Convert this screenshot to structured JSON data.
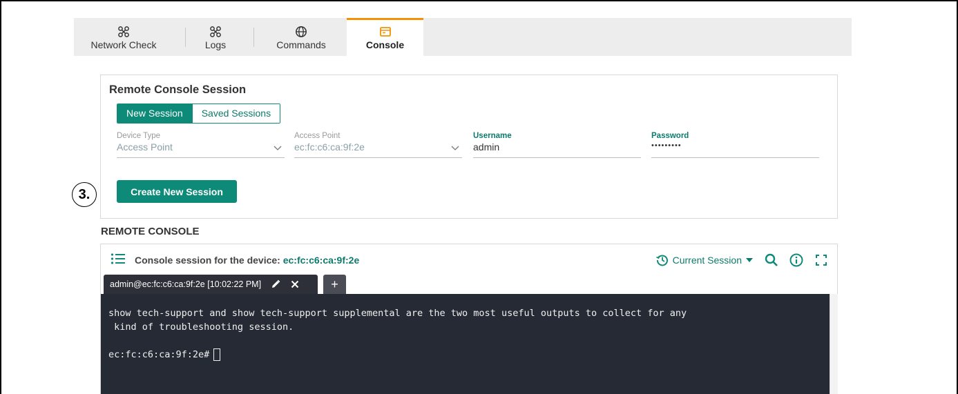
{
  "tabs": [
    {
      "label": "Network Check",
      "icon": "network-icon"
    },
    {
      "label": "Logs",
      "icon": "network-icon"
    },
    {
      "label": "Commands",
      "icon": "globe-icon"
    },
    {
      "label": "Console",
      "icon": "console-icon",
      "active": true
    }
  ],
  "session": {
    "title": "Remote Console Session",
    "segments": [
      "New Session",
      "Saved Sessions"
    ],
    "fields": {
      "device_type": {
        "label": "Device Type",
        "value": "Access Point"
      },
      "access_point": {
        "label": "Access Point",
        "value": "ec:fc:c6:ca:9f:2e"
      },
      "username": {
        "label": "Username",
        "value": "admin"
      },
      "password": {
        "label": "Password",
        "value": "•••••••••"
      }
    },
    "create_button": "Create New Session"
  },
  "step_badge": "3.",
  "remote_console": {
    "section_label": "REMOTE CONSOLE",
    "session_prefix": "Console session for the device: ",
    "device_id": "ec:fc:c6:ca:9f:2e",
    "current_session_label": "Current Session",
    "term_tab_title": "admin@ec:fc:c6:ca:9f:2e [10:02:22 PM]",
    "add_tab_label": "+",
    "terminal_message": "show tech-support and show tech-support supplemental are the two most useful outputs to collect for any\n kind of troubleshooting session.",
    "prompt": "ec:fc:c6:ca:9f:2e#"
  },
  "colors": {
    "accent": "#0d8a78",
    "active_tab_border": "#f39200",
    "terminal_bg": "#252a35"
  }
}
